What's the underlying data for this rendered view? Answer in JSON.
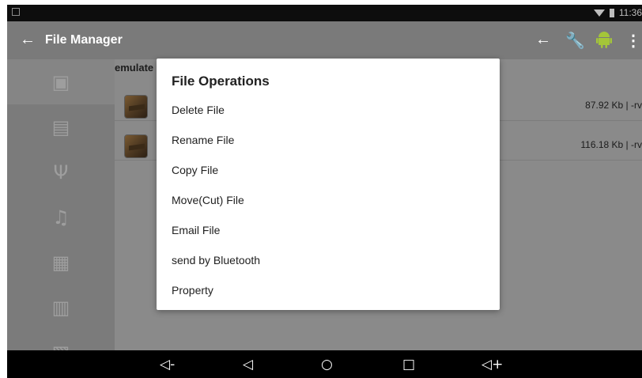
{
  "status_bar": {
    "time": "11:36"
  },
  "app_bar": {
    "title": "File Manager",
    "back_icon": "arrow-left-icon",
    "actions": [
      "arrow-left-icon",
      "wrench-icon",
      "android-icon",
      "more-vert-icon"
    ],
    "action_colors": [
      "#ffffff",
      "#a0a0a0",
      "#a4c639",
      "#ffffff"
    ]
  },
  "sidebar": {
    "items": [
      {
        "icon": "storage-icon",
        "active": true
      },
      {
        "icon": "sd-card-icon"
      },
      {
        "icon": "usb-icon"
      },
      {
        "icon": "music-icon"
      },
      {
        "icon": "image-icon"
      },
      {
        "icon": "video-icon"
      },
      {
        "icon": "archive-icon"
      }
    ]
  },
  "main": {
    "path": "emulate",
    "files": [
      {
        "meta": "87.92 Kb  | -rv"
      },
      {
        "meta": "116.18 Kb  | -rv"
      }
    ]
  },
  "dialog": {
    "title": "File Operations",
    "items": [
      {
        "label": "Delete File"
      },
      {
        "label": "Rename File"
      },
      {
        "label": "Copy File"
      },
      {
        "label": "Move(Cut) File"
      },
      {
        "label": "Email File"
      },
      {
        "label": "send by Bluetooth"
      },
      {
        "label": "Property"
      }
    ]
  },
  "nav_bar": {
    "buttons": [
      "volume-down-icon",
      "back-triangle-icon",
      "home-circle-icon",
      "recents-square-icon",
      "volume-up-icon"
    ]
  }
}
